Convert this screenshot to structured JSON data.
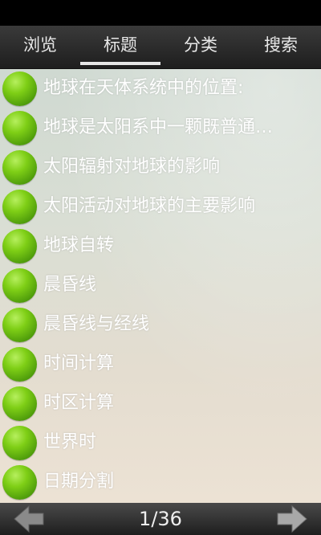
{
  "tabs": [
    {
      "label": "浏览",
      "active": false
    },
    {
      "label": "标题",
      "active": true
    },
    {
      "label": "分类",
      "active": false
    },
    {
      "label": "搜索",
      "active": false
    }
  ],
  "list": {
    "bullet_icon": "green-ball-icon",
    "items": [
      {
        "label": "地球在天体系统中的位置:"
      },
      {
        "label": "地球是太阳系中一颗既普通又特殊的行星"
      },
      {
        "label": "太阳辐射对地球的影响"
      },
      {
        "label": "太阳活动对地球的主要影响"
      },
      {
        "label": "地球自转"
      },
      {
        "label": "晨昏线"
      },
      {
        "label": "晨昏线与经线"
      },
      {
        "label": "时间计算"
      },
      {
        "label": "时区计算"
      },
      {
        "label": "世界时"
      },
      {
        "label": "日期分割"
      }
    ]
  },
  "pager": {
    "text": "1/36",
    "prev_icon": "arrow-left-icon",
    "next_icon": "arrow-right-icon"
  },
  "colors": {
    "bullet": "#6fbf12",
    "tab_bar": "#2b2b2b",
    "text": "#ffffff"
  }
}
